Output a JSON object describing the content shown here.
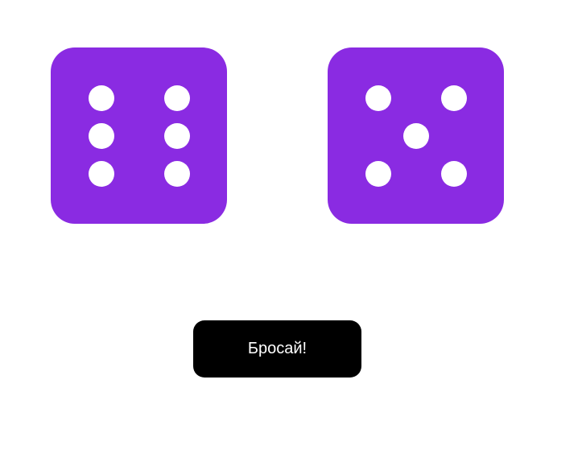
{
  "colors": {
    "die_face": "#8a2be2",
    "pip": "#ffffff",
    "button_background": "#000000",
    "button_text": "#ffffff",
    "page_background": "#ffffff"
  },
  "dice": [
    {
      "value": 6
    },
    {
      "value": 5
    }
  ],
  "roll_button": {
    "label": "Бросай!"
  }
}
